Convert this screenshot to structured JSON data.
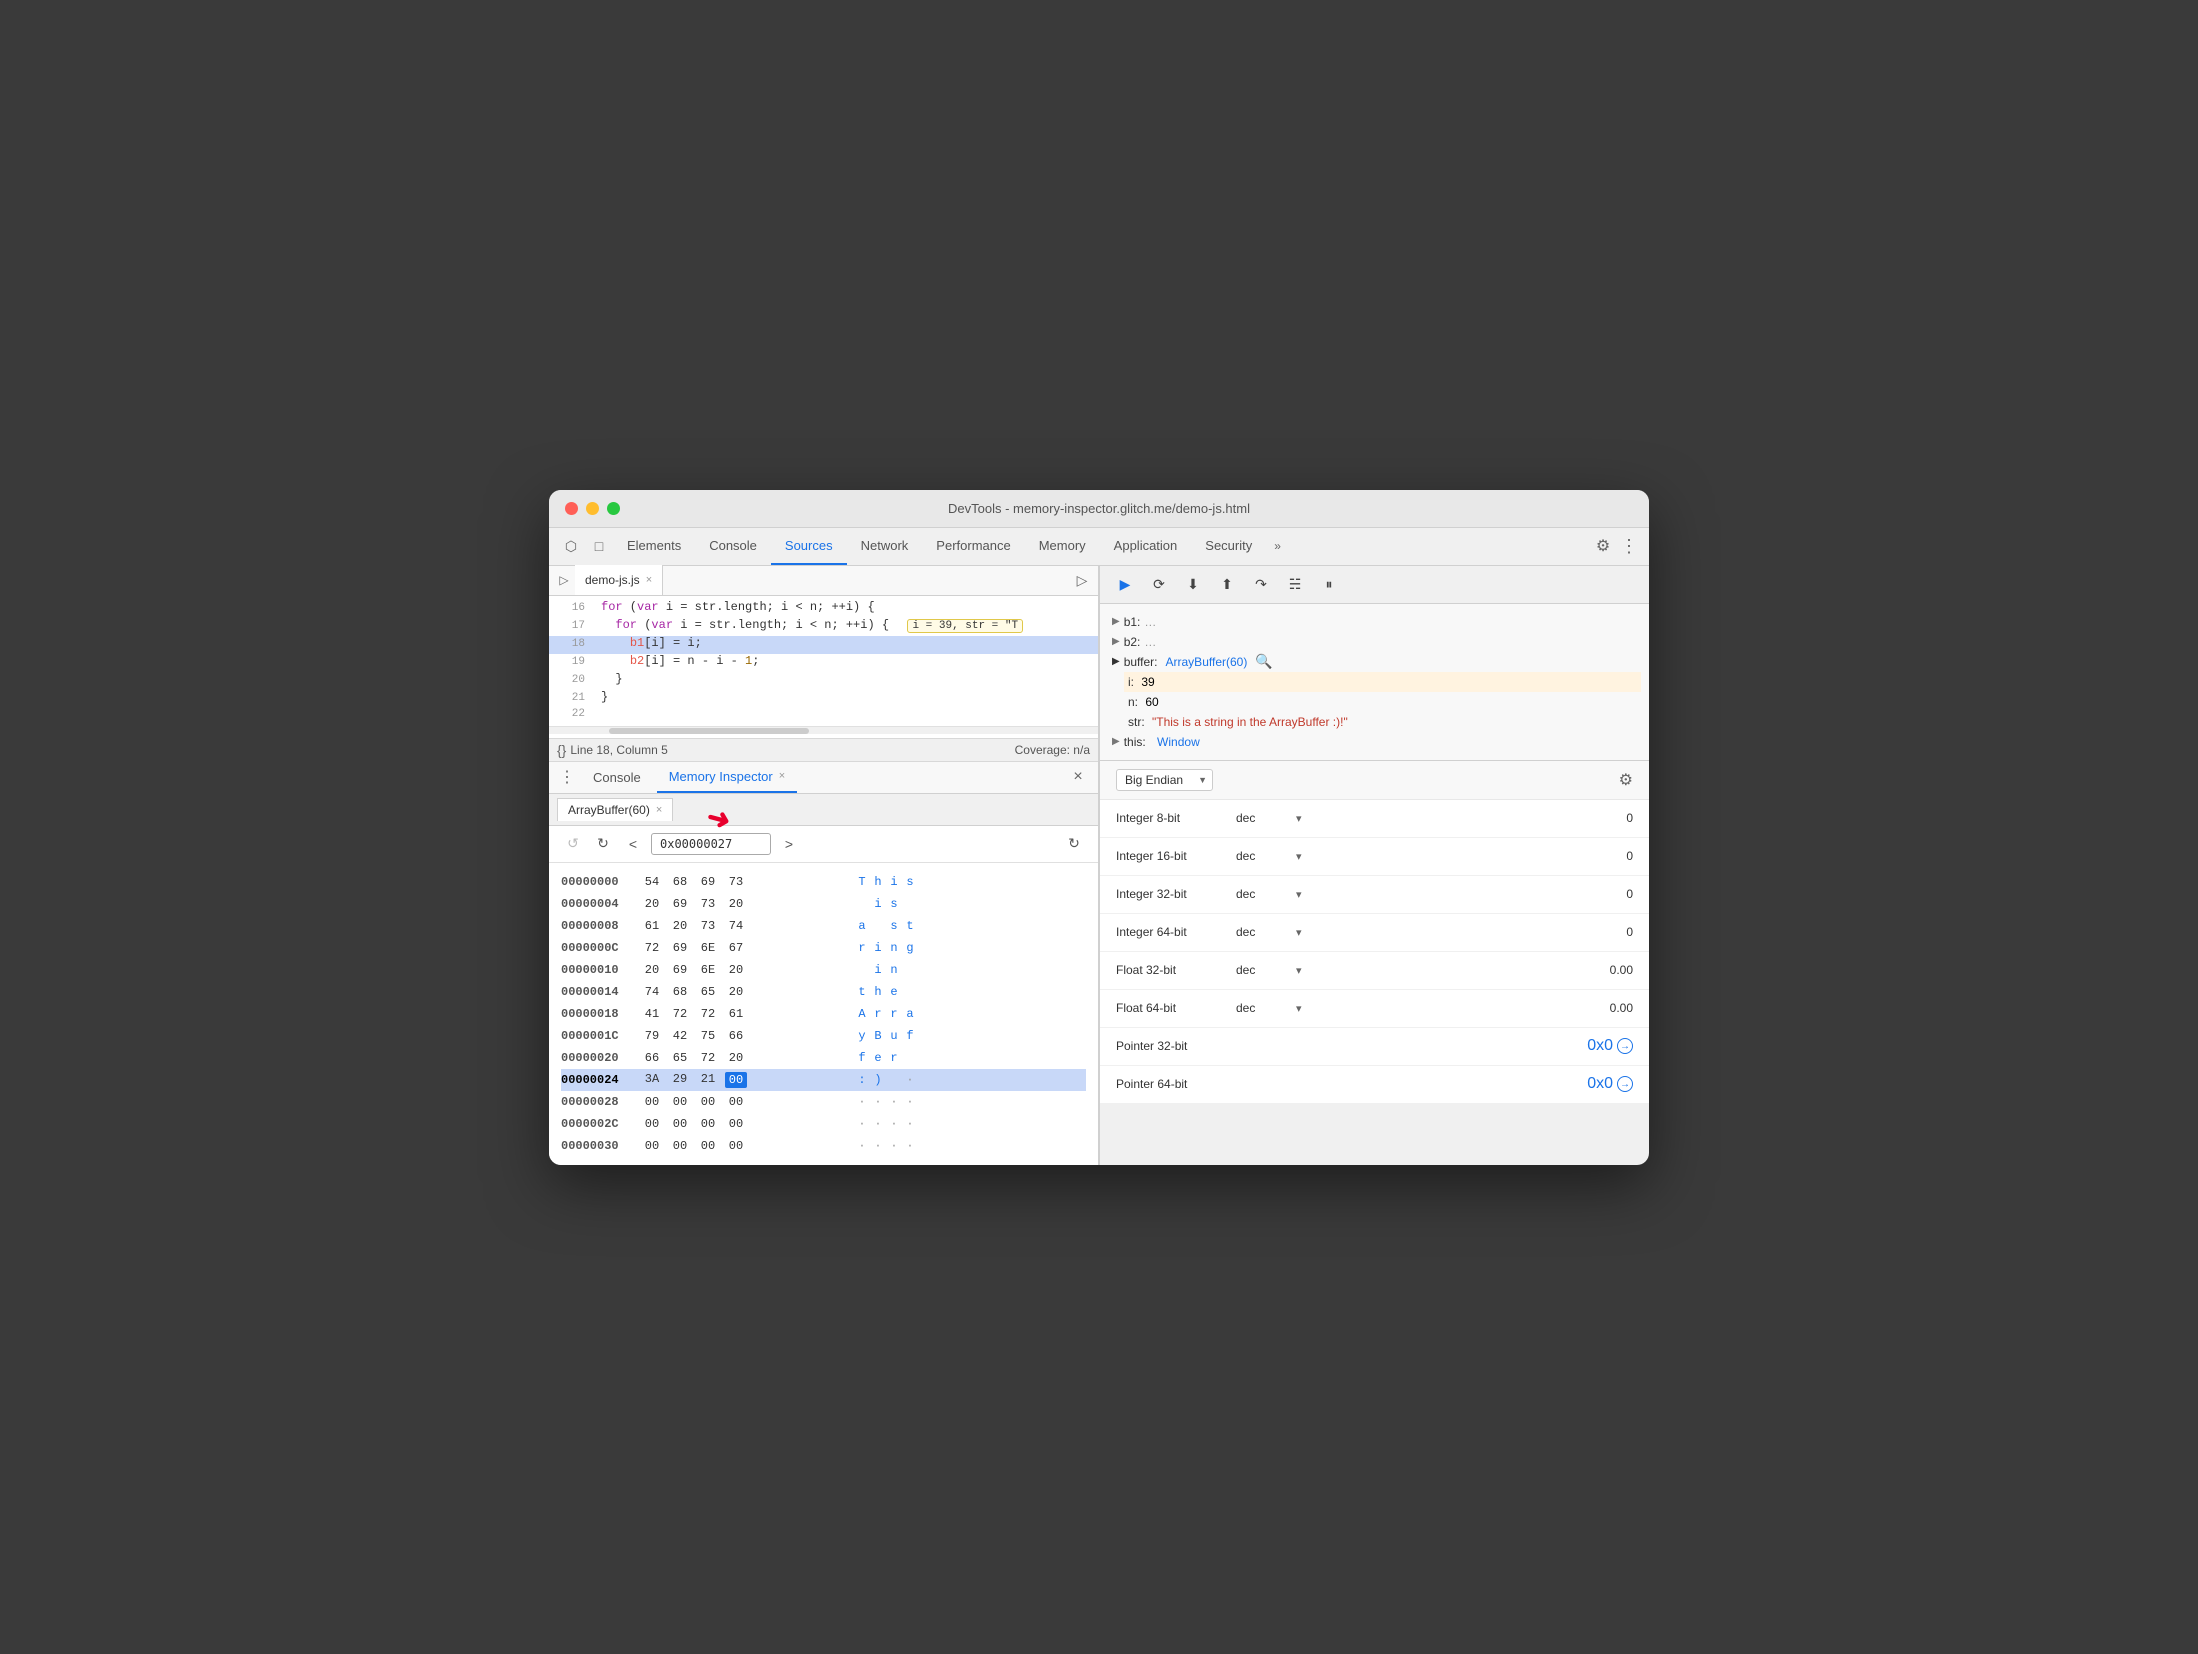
{
  "window": {
    "title": "DevTools - memory-inspector.glitch.me/demo-js.html"
  },
  "devtools_tabs": {
    "items": [
      "Elements",
      "Console",
      "Sources",
      "Network",
      "Performance",
      "Memory",
      "Application",
      "Security"
    ],
    "active": "Sources",
    "more_label": "»"
  },
  "source_tab": {
    "filename": "demo-js.js",
    "close": "×"
  },
  "code": {
    "lines": [
      {
        "num": "16",
        "content": "for (var i = str.length; i < n; ++i) {",
        "highlight": false,
        "inline_val": null
      },
      {
        "num": "17",
        "content": "  for (var i = str.length; i < n; ++i) {",
        "highlight": false,
        "inline_val": "i = 39, str = \"T"
      },
      {
        "num": "18",
        "content": "    b1[i] = i;",
        "highlight": true,
        "inline_val": null
      },
      {
        "num": "19",
        "content": "    b2[i] = n - i - 1;",
        "highlight": false,
        "inline_val": null
      },
      {
        "num": "20",
        "content": "  }",
        "highlight": false,
        "inline_val": null
      },
      {
        "num": "21",
        "content": "}",
        "highlight": false,
        "inline_val": null
      },
      {
        "num": "22",
        "content": "",
        "highlight": false,
        "inline_val": null
      }
    ]
  },
  "status_bar": {
    "icon_label": "{}",
    "position_label": "Line 18, Column 5",
    "coverage_label": "Coverage: n/a"
  },
  "bottom_tabs": {
    "items": [
      "Console",
      "Memory Inspector"
    ],
    "active": "Memory Inspector",
    "close": "×"
  },
  "bottom_panel_close": "×",
  "memory_inspector": {
    "buffer_tab_label": "ArrayBuffer(60)",
    "buffer_tab_close": "×",
    "nav": {
      "back_disabled": true,
      "forward_disabled": false,
      "prev_label": "<",
      "next_label": ">",
      "address": "0x00000027",
      "refresh_label": "↻"
    },
    "rows": [
      {
        "addr": "00000000",
        "bytes": [
          "54",
          "68",
          "69",
          "73"
        ],
        "chars": [
          "T",
          "h",
          "i",
          "s"
        ],
        "highlight": false
      },
      {
        "addr": "00000004",
        "bytes": [
          "20",
          "69",
          "73",
          "20"
        ],
        "chars": [
          " ",
          "i",
          "s",
          " "
        ],
        "highlight": false
      },
      {
        "addr": "00000008",
        "bytes": [
          "61",
          "20",
          "73",
          "74"
        ],
        "chars": [
          "a",
          " ",
          "s",
          "t"
        ],
        "highlight": false
      },
      {
        "addr": "0000000C",
        "bytes": [
          "72",
          "69",
          "6E",
          "67"
        ],
        "chars": [
          "r",
          "i",
          "n",
          "g"
        ],
        "highlight": false
      },
      {
        "addr": "00000010",
        "bytes": [
          "20",
          "69",
          "6E",
          "20"
        ],
        "chars": [
          " ",
          "i",
          "n",
          " "
        ],
        "highlight": false
      },
      {
        "addr": "00000014",
        "bytes": [
          "74",
          "68",
          "65",
          "20"
        ],
        "chars": [
          "t",
          "h",
          "e",
          " "
        ],
        "highlight": false
      },
      {
        "addr": "00000018",
        "bytes": [
          "41",
          "72",
          "72",
          "61"
        ],
        "chars": [
          "A",
          "r",
          "r",
          "a"
        ],
        "highlight": false
      },
      {
        "addr": "0000001C",
        "bytes": [
          "79",
          "42",
          "75",
          "66"
        ],
        "chars": [
          "y",
          "B",
          "u",
          "f"
        ],
        "highlight": false
      },
      {
        "addr": "00000020",
        "bytes": [
          "66",
          "65",
          "72",
          "20"
        ],
        "chars": [
          "f",
          "e",
          "r",
          " "
        ],
        "highlight": false
      },
      {
        "addr": "00000024",
        "bytes": [
          "3A",
          "29",
          "21",
          "00"
        ],
        "chars": [
          ":",
          ")",
          " ",
          "·"
        ],
        "highlight": true,
        "selected_byte_idx": 3
      },
      {
        "addr": "00000028",
        "bytes": [
          "00",
          "00",
          "00",
          "00"
        ],
        "chars": [
          "·",
          "·",
          "·",
          "·"
        ],
        "highlight": false
      },
      {
        "addr": "0000002C",
        "bytes": [
          "00",
          "00",
          "00",
          "00"
        ],
        "chars": [
          "·",
          "·",
          "·",
          "·"
        ],
        "highlight": false
      },
      {
        "addr": "00000030",
        "bytes": [
          "00",
          "00",
          "00",
          "00"
        ],
        "chars": [
          "·",
          "·",
          "·",
          "·"
        ],
        "highlight": false
      }
    ]
  },
  "debugger": {
    "toolbar_btns": [
      "▶",
      "⟳",
      "⬇",
      "⬆",
      "↷",
      "☵",
      "⏸"
    ],
    "scope_vars": [
      {
        "key": "b1:",
        "val": "…",
        "expanded": false,
        "indent": 0
      },
      {
        "key": "b2:",
        "val": "…",
        "expanded": false,
        "indent": 0
      },
      {
        "key": "buffer:",
        "val": "ArrayBuffer(60) 🔍",
        "expanded": true,
        "indent": 0
      },
      {
        "key": "i:",
        "val": "39",
        "indent": 1
      },
      {
        "key": "n:",
        "val": "60",
        "indent": 1
      },
      {
        "key": "str:",
        "val": "\"This is a string in the ArrayBuffer :)!\"",
        "indent": 1
      },
      {
        "key": "▶ this:",
        "val": "Window",
        "indent": 0
      }
    ]
  },
  "memory_right": {
    "endian": "Big Endian",
    "types": [
      {
        "label": "Integer 8-bit",
        "format": "dec",
        "value": "0",
        "is_link": false
      },
      {
        "label": "Integer 16-bit",
        "format": "dec",
        "value": "0",
        "is_link": false
      },
      {
        "label": "Integer 32-bit",
        "format": "dec",
        "value": "0",
        "is_link": false
      },
      {
        "label": "Integer 64-bit",
        "format": "dec",
        "value": "0",
        "is_link": false
      },
      {
        "label": "Float 32-bit",
        "format": "dec",
        "value": "0.00",
        "is_link": false
      },
      {
        "label": "Float 64-bit",
        "format": "dec",
        "value": "0.00",
        "is_link": false
      },
      {
        "label": "Pointer 32-bit",
        "format": "",
        "value": "0x0",
        "is_link": true
      },
      {
        "label": "Pointer 64-bit",
        "format": "",
        "value": "0x0",
        "is_link": true
      }
    ]
  }
}
